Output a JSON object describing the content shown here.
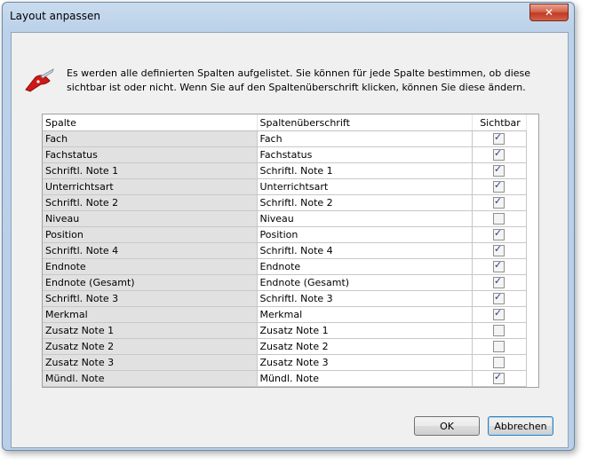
{
  "window": {
    "title": "Layout anpassen",
    "close_symbol": "✕"
  },
  "info": {
    "icon": "pocket-knife-icon",
    "text": "Es werden alle definierten Spalten aufgelistet. Sie können für jede Spalte bestimmen, ob diese sichtbar ist oder nicht. Wenn Sie auf den Spaltenüberschrift klicken, können Sie diese ändern."
  },
  "grid": {
    "headers": [
      "Spalte",
      "Spaltenüberschrift",
      "Sichtbar"
    ],
    "rows": [
      {
        "spalte": "Fach",
        "ueberschrift": "Fach",
        "sichtbar": true
      },
      {
        "spalte": "Fachstatus",
        "ueberschrift": "Fachstatus",
        "sichtbar": true
      },
      {
        "spalte": "Schriftl. Note 1",
        "ueberschrift": "Schriftl. Note 1",
        "sichtbar": true
      },
      {
        "spalte": "Unterrichtsart",
        "ueberschrift": "Unterrichtsart",
        "sichtbar": true
      },
      {
        "spalte": "Schriftl. Note 2",
        "ueberschrift": "Schriftl. Note 2",
        "sichtbar": true
      },
      {
        "spalte": "Niveau",
        "ueberschrift": "Niveau",
        "sichtbar": false
      },
      {
        "spalte": "Position",
        "ueberschrift": "Position",
        "sichtbar": true
      },
      {
        "spalte": "Schriftl. Note 4",
        "ueberschrift": "Schriftl. Note 4",
        "sichtbar": true
      },
      {
        "spalte": "Endnote",
        "ueberschrift": "Endnote",
        "sichtbar": true
      },
      {
        "spalte": "Endnote (Gesamt)",
        "ueberschrift": "Endnote (Gesamt)",
        "sichtbar": true
      },
      {
        "spalte": "Schriftl. Note 3",
        "ueberschrift": "Schriftl. Note 3",
        "sichtbar": true
      },
      {
        "spalte": "Merkmal",
        "ueberschrift": "Merkmal",
        "sichtbar": true
      },
      {
        "spalte": "Zusatz Note 1",
        "ueberschrift": "Zusatz Note 1",
        "sichtbar": false
      },
      {
        "spalte": "Zusatz Note 2",
        "ueberschrift": "Zusatz Note 2",
        "sichtbar": false
      },
      {
        "spalte": "Zusatz Note 3",
        "ueberschrift": "Zusatz Note 3",
        "sichtbar": false
      },
      {
        "spalte": "Mündl. Note",
        "ueberschrift": "Mündl. Note",
        "sichtbar": true
      }
    ]
  },
  "buttons": {
    "ok": "OK",
    "cancel": "Abbrechen"
  },
  "colors": {
    "icon_red": "#d01818",
    "accent": "#3c7fb1"
  }
}
